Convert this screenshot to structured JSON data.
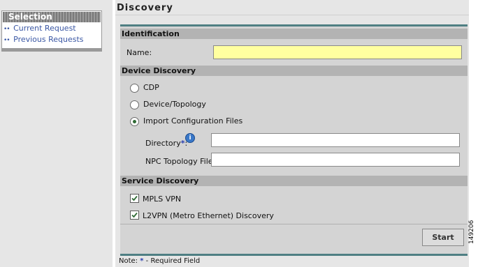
{
  "sidebar": {
    "header": "Selection",
    "items": [
      {
        "label": "Current Request"
      },
      {
        "label": "Previous Requests"
      }
    ]
  },
  "page": {
    "title": "Discovery"
  },
  "sections": {
    "identification": {
      "title": "Identification",
      "name_label": "Name:",
      "name_value": ""
    },
    "device_discovery": {
      "title": "Device Discovery",
      "options": [
        {
          "label": "CDP",
          "selected": false
        },
        {
          "label": "Device/Topology",
          "selected": false
        },
        {
          "label": "Import Configuration Files",
          "selected": true
        }
      ],
      "directory_label": "Directory",
      "directory_value": "",
      "npc_label": "NPC Topology File:",
      "npc_value": ""
    },
    "service_discovery": {
      "title": "Service Discovery",
      "options": [
        {
          "label": "MPLS VPN",
          "checked": true
        },
        {
          "label": "L2VPN (Metro Ethernet) Discovery",
          "checked": true
        }
      ]
    }
  },
  "actions": {
    "start_label": "Start"
  },
  "note": {
    "prefix": "Note:",
    "star": "*",
    "text": "- Required Field"
  },
  "figure_number": "149206",
  "colors": {
    "accent_rule": "#4f7f83",
    "link": "#3a57a4",
    "name_field": "#ffffa0"
  },
  "icons": {
    "info": "info-icon",
    "required": "required-star"
  }
}
